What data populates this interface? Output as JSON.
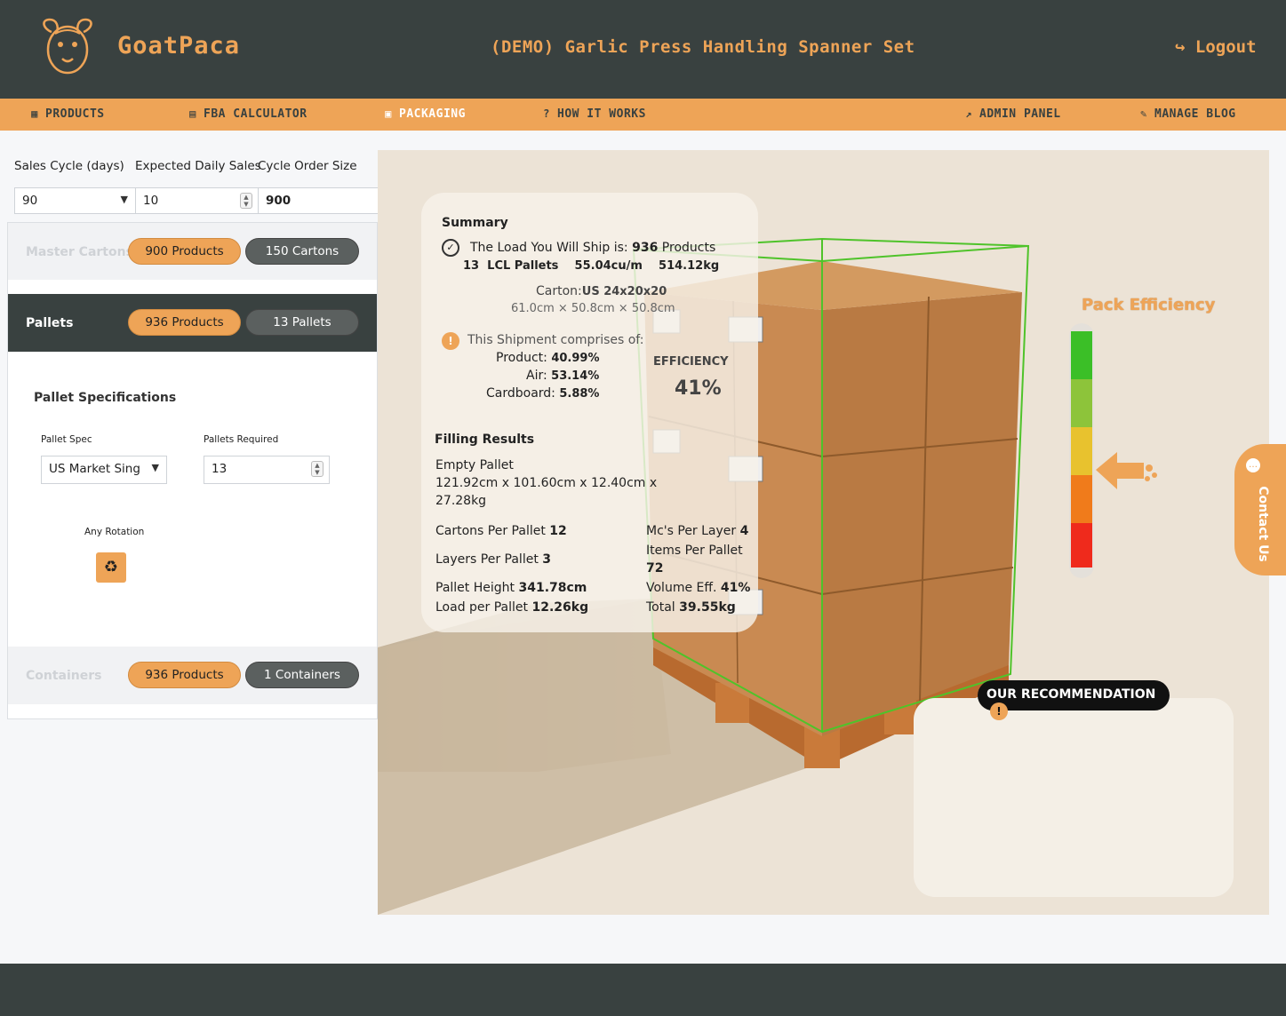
{
  "header": {
    "brand": "GoatPaca",
    "product_title": "(DEMO) Garlic Press Handling Spanner Set",
    "logout_label": "Logout"
  },
  "nav": {
    "products": "PRODUCTS",
    "fba_calculator": "FBA CALCULATOR",
    "packaging": "PACKAGING",
    "how_it_works": "HOW IT WORKS",
    "admin_panel": "ADMIN PANEL",
    "manage_blog": "MANAGE BLOG"
  },
  "inputs": {
    "sales_cycle_label": "Sales Cycle (days)",
    "sales_cycle_value": "90",
    "expected_daily_label": "Expected Daily Sales",
    "expected_daily_value": "10",
    "cycle_order_label": "Cycle Order Size",
    "cycle_order_value": "900"
  },
  "sections": {
    "master_cartons": {
      "label": "Master Cartons",
      "products": "900 Products",
      "count": "150 Cartons"
    },
    "pallets": {
      "label": "Pallets",
      "products": "936 Products",
      "count": "13 Pallets"
    },
    "containers": {
      "label": "Containers",
      "products": "936 Products",
      "count": "1 Containers"
    }
  },
  "pallet_spec": {
    "title": "Pallet Specifications",
    "spec_label": "Pallet Spec",
    "spec_value": "US Market Sing",
    "required_label": "Pallets Required",
    "required_value": "13",
    "rotation_label": "Any Rotation"
  },
  "summary": {
    "title": "Summary",
    "load_prefix": "The Load You Will Ship is:",
    "load_products": "936",
    "load_products_unit": "Products",
    "load_count": "13",
    "load_type": "LCL Pallets",
    "load_volume": "55.04cu/m",
    "load_weight": "514.12kg",
    "carton_label": "Carton:",
    "carton_value": "US 24x20x20",
    "carton_dims": "61.0cm × 50.8cm × 50.8cm",
    "comprises_label": "This Shipment comprises of:",
    "product_label": "Product:",
    "product_pct": "40.99%",
    "air_label": "Air:",
    "air_pct": "53.14%",
    "cardboard_label": "Cardboard:",
    "cardboard_pct": "5.88%",
    "efficiency_label": "EFFICIENCY",
    "efficiency_value": "41%",
    "filling_title": "Filling Results",
    "empty_pallet_label": "Empty Pallet",
    "empty_pallet_line1": "121.92cm x 101.60cm x 12.40cm x",
    "empty_pallet_line2": "27.28kg",
    "cartons_per_pallet_label": "Cartons Per Pallet",
    "cartons_per_pallet": "12",
    "mcs_per_layer_label": "Mc's Per Layer",
    "mcs_per_layer": "4",
    "layers_per_pallet_label": "Layers Per Pallet",
    "layers_per_pallet": "3",
    "items_per_pallet_label": "Items Per Pallet",
    "items_per_pallet": "72",
    "pallet_height_label": "Pallet Height",
    "pallet_height": "341.78cm",
    "volume_eff_label": "Volume Eff.",
    "volume_eff": "41%",
    "load_per_pallet_label": "Load per Pallet",
    "load_per_pallet": "12.26kg",
    "total_label": "Total",
    "total": "39.55kg"
  },
  "pack_efficiency": {
    "title": "Pack Efficiency",
    "level": 0.41,
    "colors": [
      "#3bbf27",
      "#8dc43a",
      "#e8c22e",
      "#f07b1b",
      "#ef2a1c"
    ]
  },
  "recommendation": {
    "label": "OUR RECOMMENDATION"
  },
  "contact": {
    "label": "Contact Us"
  },
  "colors": {
    "accent": "#eea457",
    "dark": "#394140"
  }
}
